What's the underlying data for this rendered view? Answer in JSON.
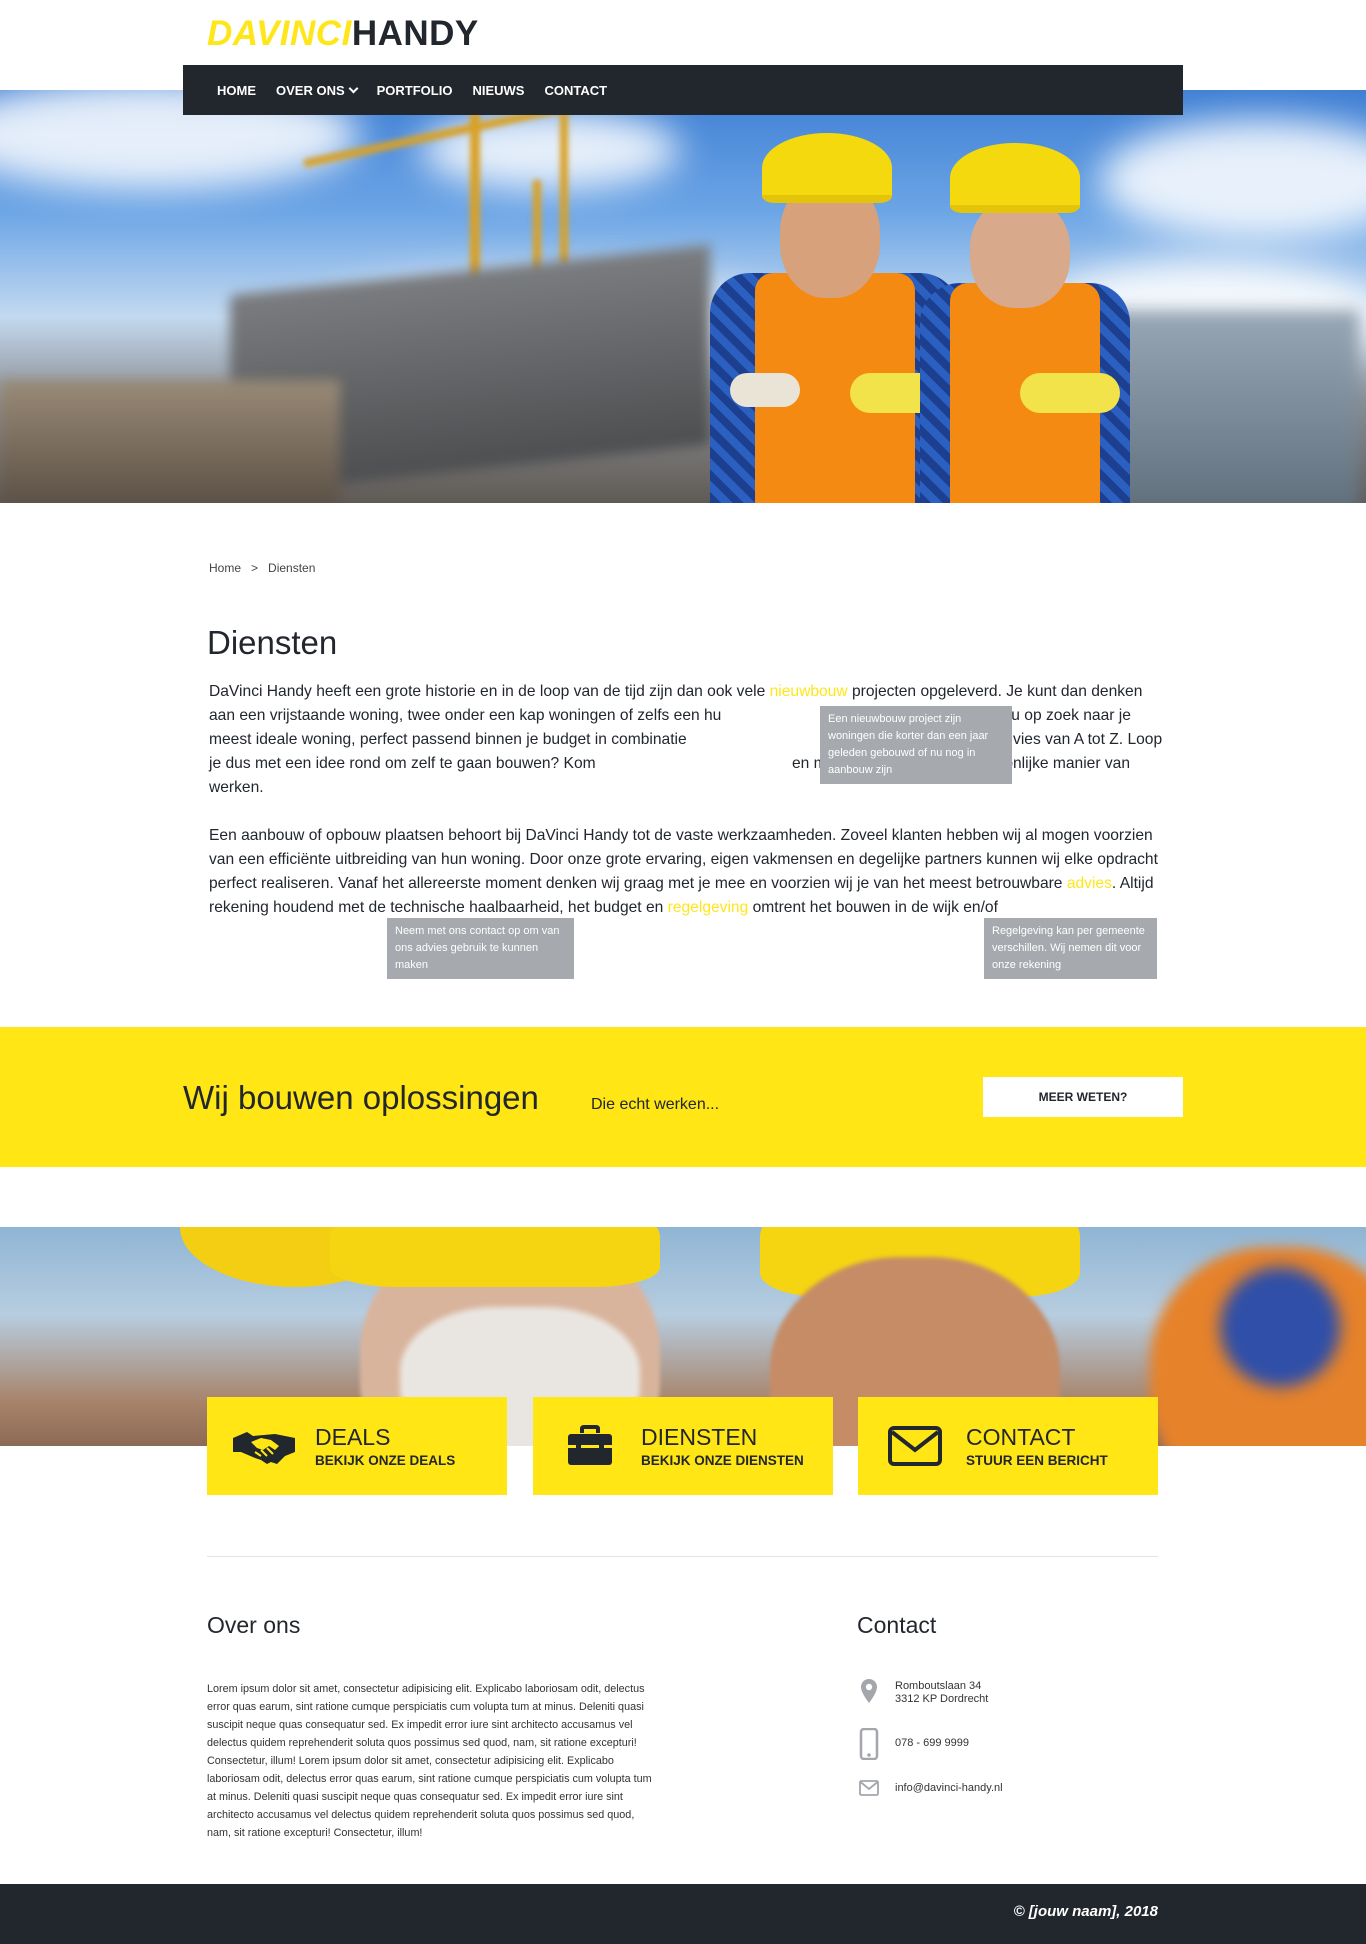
{
  "brand": {
    "logo_part1": "DAVINCI",
    "logo_part2": "HANDY",
    "accent": "#ffe614",
    "dark": "#22262d"
  },
  "nav": {
    "items": [
      "HOME",
      "OVER ONS",
      "PORTFOLIO",
      "NIEUWS",
      "CONTACT"
    ]
  },
  "breadcrumb": {
    "home": "Home",
    "sep": ">",
    "current": "Diensten"
  },
  "page": {
    "title": "Diensten",
    "p1": {
      "a": "DaVinci Handy heeft een grote historie en in de loop van de tijd zijn dan ook vele ",
      "link": "nieuwbouw",
      "b": " projecten opgeleverd. Je kunt dan denken aan een vrijstaande woning, twee onder een kap woningen of zelfs een hu",
      "c": " samen met jou op zoek naar je meest ideale woning, perfect passend binnen je budget in combinatie",
      "d": "iteit en het juiste advies van A tot Z. Loop je dus met een idee rond om zelf te gaan bouwen? Kom ",
      "e": "en maak kennis met ons persoonlijke manier van werken."
    },
    "p2": {
      "a": "Een aanbouw of opbouw plaatsen behoort bij DaVinci Handy tot de vaste werkzaamheden. Zoveel klanten hebben wij al mogen voorzien van een efficiënte uitbreiding van hun woning. Door onze grote ervaring, eigen vakmensen en degelijke partners kunnen wij elke opdracht perfect realiseren. Vanaf het allereerste moment denken wij graag met je mee en voorzien wij je van het meest betrouwbare ",
      "link1": "advies",
      "b": ". Altijd rekening houdend met de technische haalbaarheid, het budget en ",
      "link2": "regelgeving",
      "c": " omtrent het bouwen in de wijk en/of"
    },
    "tooltips": {
      "nieuwbouw": "Een nieuwbouw project zijn woningen die korter dan een jaar geleden gebouwd of nu nog in aanbouw zijn",
      "advies": "Neem met ons contact op om van ons advies gebruik te kunnen maken",
      "regelgeving": "Regelgeving kan per gemeente verschillen. Wij nemen dit voor onze rekening"
    }
  },
  "cta": {
    "title": "Wij bouwen oplossingen",
    "subtitle": "Die echt werken...",
    "button": "MEER WETEN?"
  },
  "cards": [
    {
      "title": "DEALS",
      "subtitle": "BEKIJK ONZE DEALS",
      "icon": "handshake-icon"
    },
    {
      "title": "DIENSTEN",
      "subtitle": "BEKIJK ONZE DIENSTEN",
      "icon": "toolbox-icon"
    },
    {
      "title": "CONTACT",
      "subtitle": "STUUR EEN BERICHT",
      "icon": "envelope-icon"
    }
  ],
  "about": {
    "title": "Over ons",
    "text": "Lorem ipsum dolor sit amet, consectetur adipisicing elit. Explicabo laboriosam odit, delectus error quas earum, sint ratione cumque perspiciatis cum volupta tum at minus. Deleniti quasi suscipit neque quas consequatur sed. Ex impedit error iure sint architecto accusamus vel delectus quidem reprehenderit soluta quos possimus sed quod, nam, sit ratione excepturi! Consectetur, illum! Lorem ipsum dolor sit amet, consectetur adipisicing elit. Explicabo laboriosam odit, delectus error quas earum, sint ratione cumque perspiciatis cum volupta tum at minus. Deleniti quasi suscipit neque quas consequatur sed. Ex impedit error iure sint architecto accusamus vel delectus quidem reprehenderit soluta quos possimus sed quod, nam, sit ratione excepturi! Consectetur, illum!"
  },
  "contact": {
    "title": "Contact",
    "address_line1": "Romboutslaan 34",
    "address_line2": "3312 KP Dordrecht",
    "phone": "078 - 699 9999",
    "email": "info@davinci-handy.nl"
  },
  "footer": {
    "copyright": "© [jouw naam], 2018"
  }
}
